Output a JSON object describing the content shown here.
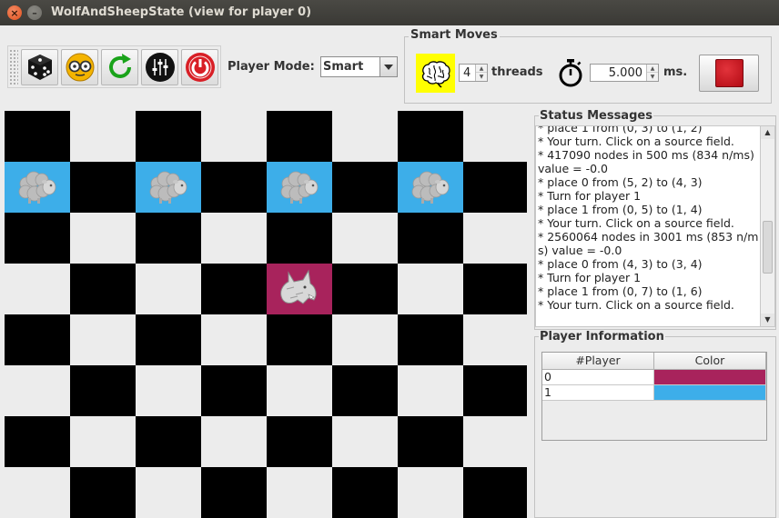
{
  "window": {
    "title": "WolfAndSheepState (view for player 0)",
    "close_glyph": "×",
    "minimize_glyph": "–"
  },
  "toolbar": {
    "icons": [
      "dice-icon",
      "glasses-icon",
      "refresh-icon",
      "settings-sliders-icon",
      "power-icon"
    ]
  },
  "player_mode": {
    "label": "Player Mode:",
    "value": "Smart"
  },
  "smart_moves": {
    "title": "Smart Moves",
    "threads_value": "4",
    "threads_label": "threads",
    "time_value": "5.000",
    "time_unit": "ms.",
    "brain_color": "#ffff00",
    "stop_color": "#c8101a"
  },
  "board": {
    "size": 8,
    "dark_color": "#000000",
    "light_color": "#ececec",
    "sheep_color": "#3daee9",
    "wolf_color": "#a8235c",
    "pieces": [
      {
        "type": "sheep",
        "row": 1,
        "col": 0
      },
      {
        "type": "sheep",
        "row": 1,
        "col": 2
      },
      {
        "type": "sheep",
        "row": 1,
        "col": 4
      },
      {
        "type": "sheep",
        "row": 1,
        "col": 6
      },
      {
        "type": "wolf",
        "row": 3,
        "col": 4
      }
    ]
  },
  "status": {
    "title": "Status Messages",
    "lines": [
      "* place 1 from (0, 3) to (1, 2)",
      "* Your turn. Click on a source field.",
      "* 417090 nodes in 500 ms (834 n/ms)",
      "value = -0.0",
      "* place 0 from (5, 2) to (4, 3)",
      "* Turn for player 1",
      "* place 1 from (0, 5) to (1, 4)",
      "* Your turn. Click on a source field.",
      "* 2560064 nodes in 3001 ms (853 n/m",
      "s) value = -0.0",
      "* place 0 from (4, 3) to (3, 4)",
      "* Turn for player 1",
      "* place 1 from (0, 7) to (1, 6)",
      "* Your turn. Click on a source field."
    ]
  },
  "players": {
    "title": "Player Information",
    "columns": [
      "#Player",
      "Color"
    ],
    "rows": [
      {
        "id": "0",
        "color": "#a8235c"
      },
      {
        "id": "1",
        "color": "#3daee9"
      }
    ]
  }
}
